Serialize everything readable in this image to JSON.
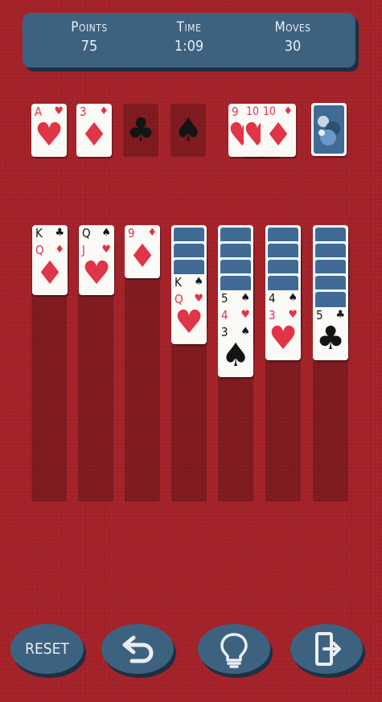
{
  "header": {
    "points_label": "Points",
    "points_value": "75",
    "time_label": "Time",
    "time_value": "1:09",
    "moves_label": "Moves",
    "moves_value": "30"
  },
  "foundations": [
    {
      "top_rank": "A",
      "top_suit": "♥",
      "color": "red"
    },
    {
      "top_rank": "3",
      "top_suit": "♦",
      "color": "red"
    },
    {
      "empty_suit": "♣"
    },
    {
      "empty_suit": "♠"
    }
  ],
  "waste": [
    {
      "rank": "9",
      "suit": "♥"
    },
    {
      "rank": "10",
      "suit": "♥"
    },
    {
      "rank": "10",
      "suit": "♦"
    }
  ],
  "tableau": [
    {
      "facedown": 0,
      "cards": [
        {
          "rank": "K",
          "suit": "♣"
        },
        {
          "rank": "Q",
          "suit": "♦"
        }
      ]
    },
    {
      "facedown": 0,
      "cards": [
        {
          "rank": "Q",
          "suit": "♠"
        },
        {
          "rank": "J",
          "suit": "♥"
        }
      ]
    },
    {
      "facedown": 0,
      "cards": [
        {
          "rank": "9",
          "suit": "♦"
        }
      ]
    },
    {
      "facedown": 3,
      "cards": [
        {
          "rank": "K",
          "suit": "♠"
        },
        {
          "rank": "Q",
          "suit": "♥"
        }
      ]
    },
    {
      "facedown": 4,
      "cards": [
        {
          "rank": "5",
          "suit": "♠"
        },
        {
          "rank": "4",
          "suit": "♥"
        },
        {
          "rank": "3",
          "suit": "♠"
        }
      ]
    },
    {
      "facedown": 4,
      "cards": [
        {
          "rank": "4",
          "suit": "♠"
        },
        {
          "rank": "3",
          "suit": "♥"
        }
      ]
    },
    {
      "facedown": 5,
      "cards": [
        {
          "rank": "5",
          "suit": "♣"
        }
      ]
    }
  ],
  "buttons": {
    "reset_label": "RESET",
    "undo_icon": "undo-arrow-icon",
    "hint_icon": "lightbulb-icon",
    "exit_icon": "exit-door-icon"
  },
  "colors": {
    "felt": "#a8232a",
    "panel": "#3d6280",
    "card_back": "#3f6b94",
    "red_suit": "#e03447",
    "black_suit": "#141414"
  }
}
